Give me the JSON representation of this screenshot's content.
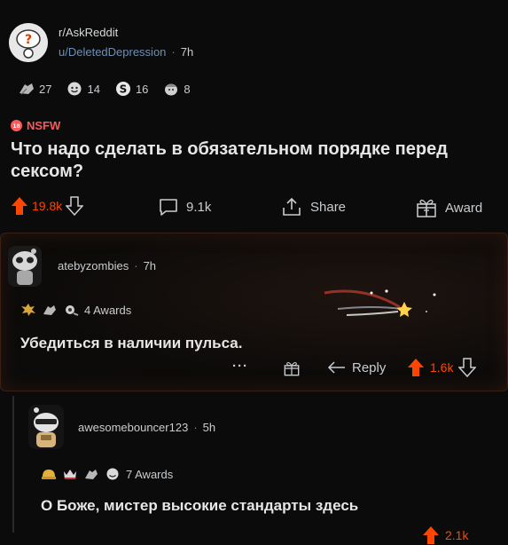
{
  "post": {
    "subreddit": "r/AskReddit",
    "author": "u/DeletedDepression",
    "time": "7h",
    "awards": [
      {
        "icon": "silver-like-award-icon",
        "count": "27"
      },
      {
        "icon": "wholesome-award-icon",
        "count": "14"
      },
      {
        "icon": "s-award-icon",
        "count": "16"
      },
      {
        "icon": "head-award-icon",
        "count": "8"
      }
    ],
    "nsfw_label": "NSFW",
    "title": "Что надо сделать в обязательном порядке перед сексом?",
    "upvotes": "19.8k",
    "comments": "9.1k",
    "share_label": "Share",
    "award_label": "Award"
  },
  "comment1": {
    "author": "atebyzombies",
    "time": "7h",
    "awards_text": "4 Awards",
    "body": "Убедиться в наличии пульса.",
    "more": "···",
    "reply_label": "Reply",
    "upvotes": "1.6k"
  },
  "comment2": {
    "author": "awesomebouncer123",
    "time": "5h",
    "awards_text": "7 Awards",
    "body": "О Боже, мистер высокие стандарты здесь",
    "upvotes": "2.1k"
  },
  "colors": {
    "upvote": "#ff4500",
    "nsfw": "#ff585b",
    "background": "#0b0b0b"
  }
}
